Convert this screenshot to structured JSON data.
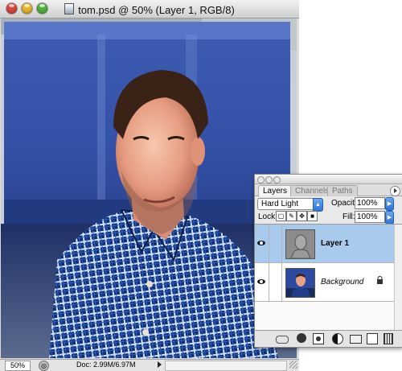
{
  "document": {
    "title": "tom.psd @ 50% (Layer 1, RGB/8)",
    "zoom": "50%",
    "doc_size": "Doc: 2.99M/6.97M"
  },
  "layers_palette": {
    "tabs": [
      "Layers",
      "Channels",
      "Paths"
    ],
    "active_tab": "Layers",
    "blend_mode": "Hard Light",
    "opacity_label": "Opacity:",
    "opacity_value": "100%",
    "lock_label": "Lock:",
    "fill_label": "Fill:",
    "fill_value": "100%",
    "layers": [
      {
        "name": "Layer 1",
        "selected": true,
        "visible": true
      },
      {
        "name": "Background",
        "selected": false,
        "visible": true,
        "locked": true
      }
    ]
  },
  "colors": {
    "selection": "#a8caec",
    "accent_blue": "#2a72d8"
  },
  "icons": {
    "title_icon": "psd-file-icon",
    "status_icon": "info-icon",
    "footer": [
      "link-layers-icon",
      "layer-style-icon",
      "layer-mask-icon",
      "adjustment-layer-icon",
      "layer-group-icon",
      "new-layer-icon",
      "trash-icon"
    ]
  }
}
